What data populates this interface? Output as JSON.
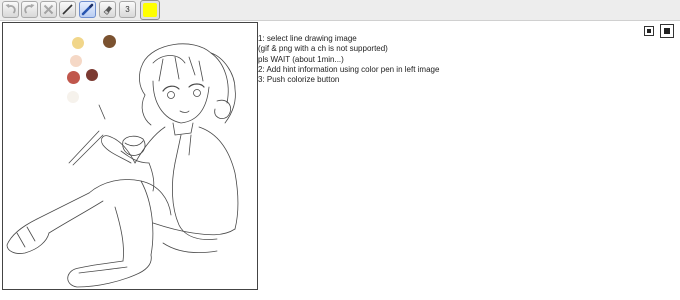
{
  "toolbar": {
    "tools": [
      {
        "name": "undo-icon",
        "state": "disabled"
      },
      {
        "name": "redo-icon",
        "state": "disabled"
      },
      {
        "name": "clear-icon",
        "state": "disabled"
      },
      {
        "name": "line-icon",
        "state": "normal"
      },
      {
        "name": "pen-icon",
        "state": "active"
      },
      {
        "name": "eraser-icon",
        "state": "normal"
      },
      {
        "name": "size-selector",
        "value": "3"
      }
    ],
    "size_value": "3",
    "current_color": "#ffff00"
  },
  "canvas": {
    "hint_colors": [
      "#f1d68a",
      "#7b5230",
      "#f5d8c6",
      "#c0574c",
      "#7c3a32",
      "#f6f2ec"
    ]
  },
  "instructions": {
    "line1": "1: select line drawing image",
    "line2": "(gif & png with a ch is not supported)",
    "line3": "pls WAIT (about 1min...)",
    "line4": "2: Add hint information using color pen in left image",
    "line5": "3: Push colorize button"
  },
  "result_buttons": [
    "save-result-icon",
    "colorize-result-icon"
  ]
}
